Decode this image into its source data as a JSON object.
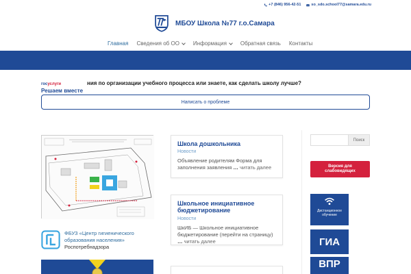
{
  "topbar": {
    "phone": "+7 (846) 956-42-51",
    "email": "so_sdo.school77@samara.edu.ru"
  },
  "header": {
    "title": "МБОУ Школа №77 г.о.Самара"
  },
  "nav": [
    {
      "label": "Главная",
      "active": true,
      "dropdown": false
    },
    {
      "label": "Сведения об ОО",
      "active": false,
      "dropdown": true
    },
    {
      "label": "Информация",
      "active": false,
      "dropdown": true
    },
    {
      "label": "Обратная связь",
      "active": false,
      "dropdown": false
    },
    {
      "label": "Контакты",
      "active": false,
      "dropdown": false
    }
  ],
  "gosuslugi": {
    "logo_part1": "гос",
    "logo_part2": "услуги",
    "question": "ния по организации учебного процесса или знаете, как сделать школу лучше?",
    "subtitle": "Решаем вместе",
    "button": "Написать о проблеме"
  },
  "fbuz": {
    "line1": "ФБУЗ «Центр гигиенического образования населения»",
    "line2": "Роспотребнадзора"
  },
  "posts": [
    {
      "title": "Школа дошкольника",
      "category": "Новости",
      "excerpt": "Объявление родителям     Форма для заполнения заявления",
      "more": "читать далее"
    },
    {
      "title": "Школьное инициативное бюджетирование",
      "category": "Новости",
      "excerpt": "ШкИБ — Школьное инициативное бюджетирование (перейти на страницу)",
      "more": "читать далее"
    }
  ],
  "sidebar": {
    "search_button": "Поиск",
    "vision_button": "Версия для слабовидящих",
    "distance_label": "Дистанционное обучение",
    "gia": "ГИА",
    "vpr": "ВПР"
  },
  "colors": {
    "brand_blue": "#1f4a96",
    "accent_red": "#d4213d",
    "link_blue": "#2e6c9e"
  }
}
